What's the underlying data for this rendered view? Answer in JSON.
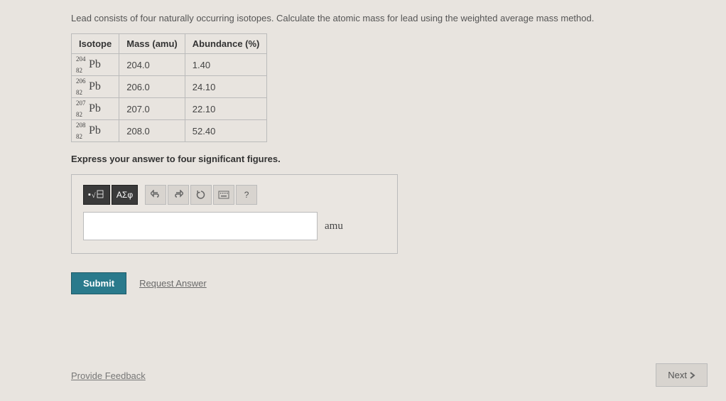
{
  "question": "Lead consists of four naturally occurring isotopes. Calculate the atomic mass for lead using the weighted average mass method.",
  "table": {
    "headers": [
      "Isotope",
      "Mass (amu)",
      "Abundance (%)"
    ],
    "rows": [
      {
        "sup": "204",
        "sub": "82",
        "sym": "Pb",
        "mass": "204.0",
        "abundance": "1.40"
      },
      {
        "sup": "206",
        "sub": "82",
        "sym": "Pb",
        "mass": "206.0",
        "abundance": "24.10"
      },
      {
        "sup": "207",
        "sub": "82",
        "sym": "Pb",
        "mass": "207.0",
        "abundance": "22.10"
      },
      {
        "sup": "208",
        "sub": "82",
        "sym": "Pb",
        "mass": "208.0",
        "abundance": "52.40"
      }
    ]
  },
  "instruction": "Express your answer to four significant figures.",
  "toolbar": {
    "greek": "ΑΣφ",
    "help": "?"
  },
  "answer": {
    "value": "",
    "unit": "amu"
  },
  "buttons": {
    "submit": "Submit",
    "request": "Request Answer",
    "next": "Next",
    "feedback": "Provide Feedback"
  }
}
